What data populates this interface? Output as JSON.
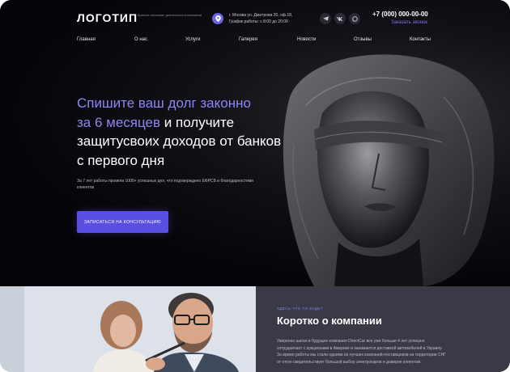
{
  "header": {
    "logo": "ЛОГОТИП",
    "tagline": "Краткое описание деятельности компании",
    "address": "г. Москва ул. Дмитрова 20, оф.18,",
    "hours": "График работы: с 8:00 до 20:00",
    "phone": "+7 (000) 000-00-00",
    "callback": "Заказать звонок",
    "social": [
      "telegram-icon",
      "vk-icon",
      "whatsapp-icon"
    ]
  },
  "nav": {
    "items": [
      "Главная",
      "О нас",
      "Услуги",
      "Галерея",
      "Новости",
      "Отзывы",
      "Контакты"
    ]
  },
  "hero": {
    "headline_accent_1": "Спишите ваш долг законно",
    "headline_accent_2": "за 6 месяцев",
    "headline_rest_1": "и получите",
    "headline_rest_2": "защитусвоих доходов от банков",
    "headline_rest_3": "с первого дня",
    "lead": "За 7 лет работы провели 1000+ успешных дел, что подтверждено ЕФРСБ и благодарностями клиентов",
    "cta": "Записаться на консультацию"
  },
  "about": {
    "kicker": "Здесь что то будет",
    "title": "Коротко о компании",
    "text": "Уверенно шагая в будущее компания DirectCar все уже больше 4 лет успешно сотрудничает с аукционами в Америке и занимается доставкой автомобилей в Украину. За время работы мы стали одними из лучших компаний-поставщиков на территории СНГ от отгон свидетельствует большой выбор электрокаров и доверие клиентов."
  },
  "colors": {
    "accent": "#8d86f5",
    "button": "#5a4fe0",
    "hero_bg": "#06050a",
    "about_bg": "#3a3a47"
  }
}
